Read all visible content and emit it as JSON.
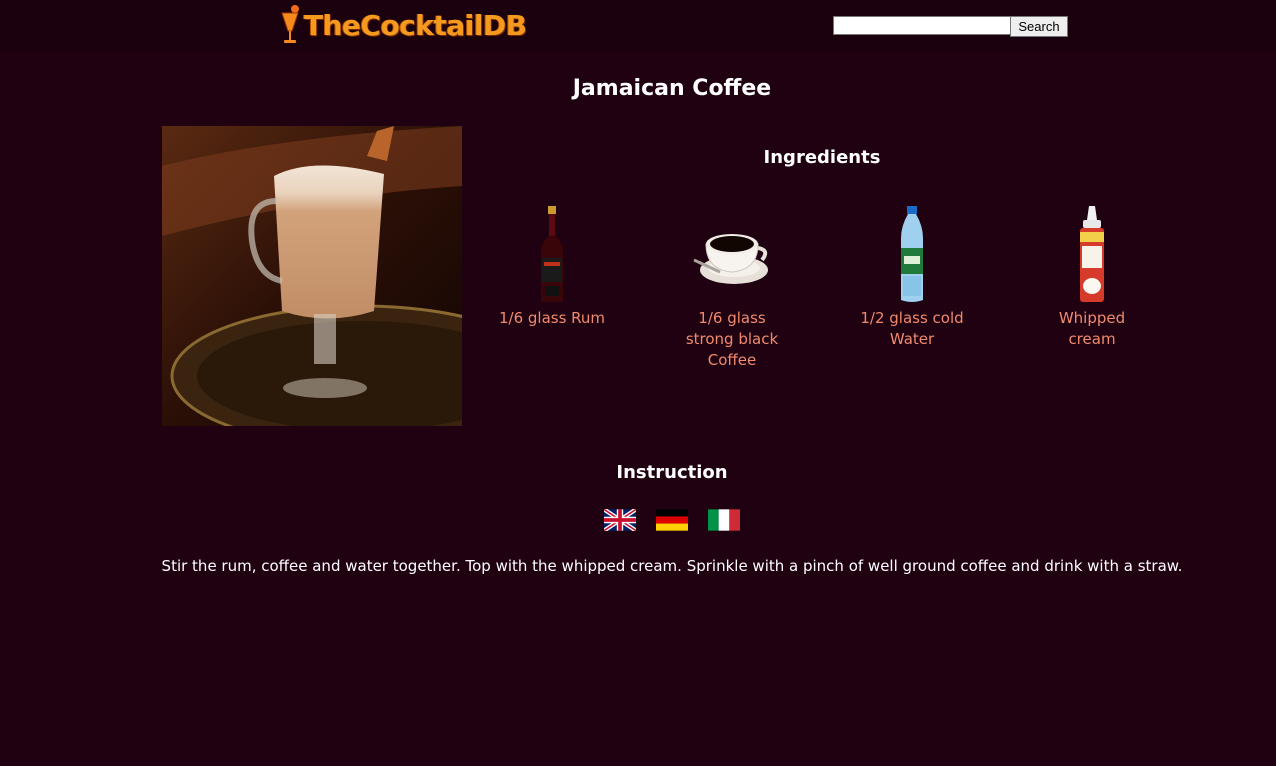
{
  "header": {
    "logo_text": "TheCocktailDB",
    "search": {
      "value": "",
      "placeholder": "",
      "button_label": "Search"
    }
  },
  "drink": {
    "name": "Jamaican Coffee"
  },
  "ingredients_section": {
    "heading": "Ingredients",
    "items": [
      {
        "label": "1/6 glass Rum",
        "icon": "rum-bottle-icon"
      },
      {
        "label": "1/6 glass strong black Coffee",
        "icon": "coffee-cup-icon"
      },
      {
        "label": "1/2 glass cold Water",
        "icon": "water-bottle-icon"
      },
      {
        "label": "Whipped cream",
        "icon": "whipped-cream-can-icon"
      }
    ]
  },
  "instructions_section": {
    "heading": "Instruction",
    "languages": [
      "english-flag-icon",
      "german-flag-icon",
      "italian-flag-icon"
    ],
    "text": "Stir the rum, coffee and water together. Top with the whipped cream. Sprinkle with a pinch of well ground coffee and drink with a straw."
  },
  "colors": {
    "background": "#200111",
    "header_background": "#1a010d",
    "link": "#f08a6e",
    "logo": "#f39a1f"
  }
}
